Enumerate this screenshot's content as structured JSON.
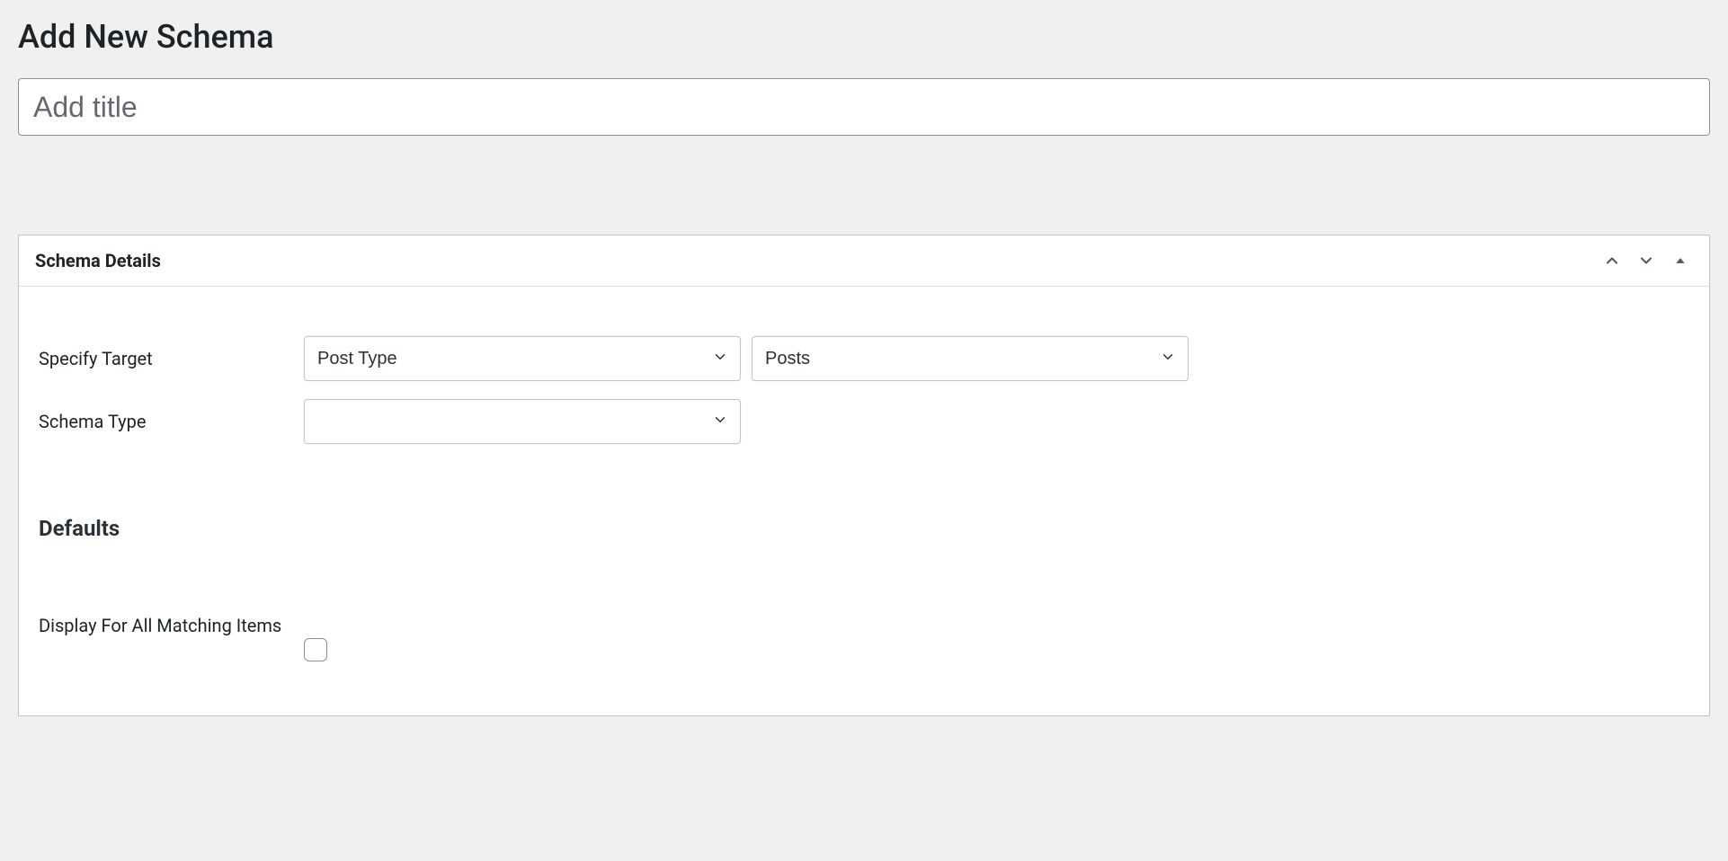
{
  "page": {
    "title": "Add New Schema"
  },
  "titleField": {
    "placeholder": "Add title",
    "value": ""
  },
  "metabox": {
    "title": "Schema Details"
  },
  "form": {
    "specifyTarget": {
      "label": "Specify Target",
      "select1": "Post Type",
      "select2": "Posts"
    },
    "schemaType": {
      "label": "Schema Type",
      "value": ""
    },
    "defaults": {
      "heading": "Defaults",
      "displayAll": {
        "label": "Display For All Matching Items"
      }
    }
  }
}
